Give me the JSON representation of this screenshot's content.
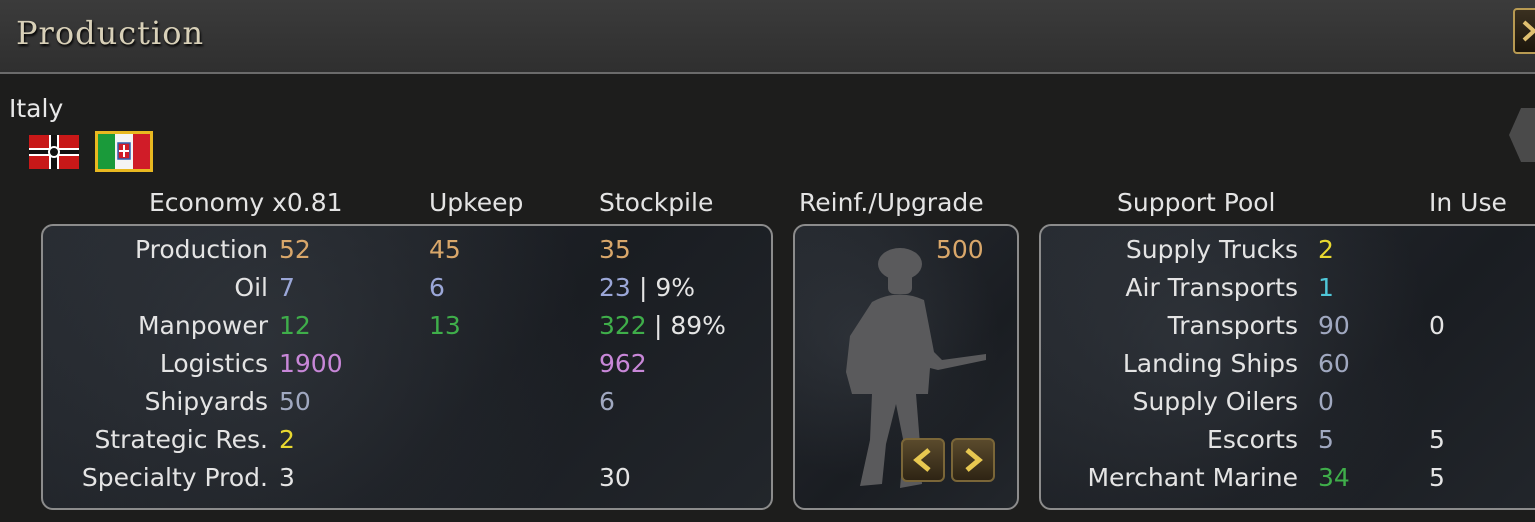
{
  "window": {
    "title": "Production"
  },
  "country": {
    "name": "Italy"
  },
  "headers": {
    "economy": "Economy x0.81",
    "upkeep": "Upkeep",
    "stockpile": "Stockpile",
    "reinf": "Reinf./Upgrade",
    "support_pool": "Support Pool",
    "in_use": "In Use"
  },
  "economy_rows": [
    {
      "label": "Production",
      "value": "52",
      "upkeep": "45",
      "stockpile": "35",
      "extra": ""
    },
    {
      "label": "Oil",
      "value": "7",
      "upkeep": "6",
      "stockpile": "23",
      "extra": "| 9%"
    },
    {
      "label": "Manpower",
      "value": "12",
      "upkeep": "13",
      "stockpile": "322",
      "extra": "| 89%"
    },
    {
      "label": "Logistics",
      "value": "1900",
      "upkeep": "",
      "stockpile": "962",
      "extra": ""
    },
    {
      "label": "Shipyards",
      "value": "50",
      "upkeep": "",
      "stockpile": "6",
      "extra": ""
    },
    {
      "label": "Strategic Res.",
      "value": "2",
      "upkeep": "",
      "stockpile": "",
      "extra": ""
    },
    {
      "label": "Specialty Prod.",
      "value": "3",
      "upkeep": "",
      "stockpile": "30",
      "extra": ""
    }
  ],
  "reinforcement": {
    "value": "500"
  },
  "support_rows": [
    {
      "label": "Supply Trucks",
      "pool": "2",
      "in_use": ""
    },
    {
      "label": "Air Transports",
      "pool": "1",
      "in_use": ""
    },
    {
      "label": "Transports",
      "pool": "90",
      "in_use": "0"
    },
    {
      "label": "Landing Ships",
      "pool": "60",
      "in_use": ""
    },
    {
      "label": "Supply Oilers",
      "pool": "0",
      "in_use": ""
    },
    {
      "label": "Escorts",
      "pool": "5",
      "in_use": "5"
    },
    {
      "label": "Merchant Marine",
      "pool": "34",
      "in_use": "5"
    }
  ],
  "colors": {
    "production": "#d9a76a",
    "oil": "#9ba7d8",
    "manpower": "#3fae4a",
    "logistics": "#c887d8",
    "strategic": "#e8d830",
    "air": "#4fc7d8",
    "selected_flag_border": "#e8b820"
  },
  "icons": {
    "close": "chevron-right-icon",
    "prev": "chevron-left-icon",
    "next": "chevron-right-icon",
    "soldier": "soldier-silhouette-icon"
  }
}
